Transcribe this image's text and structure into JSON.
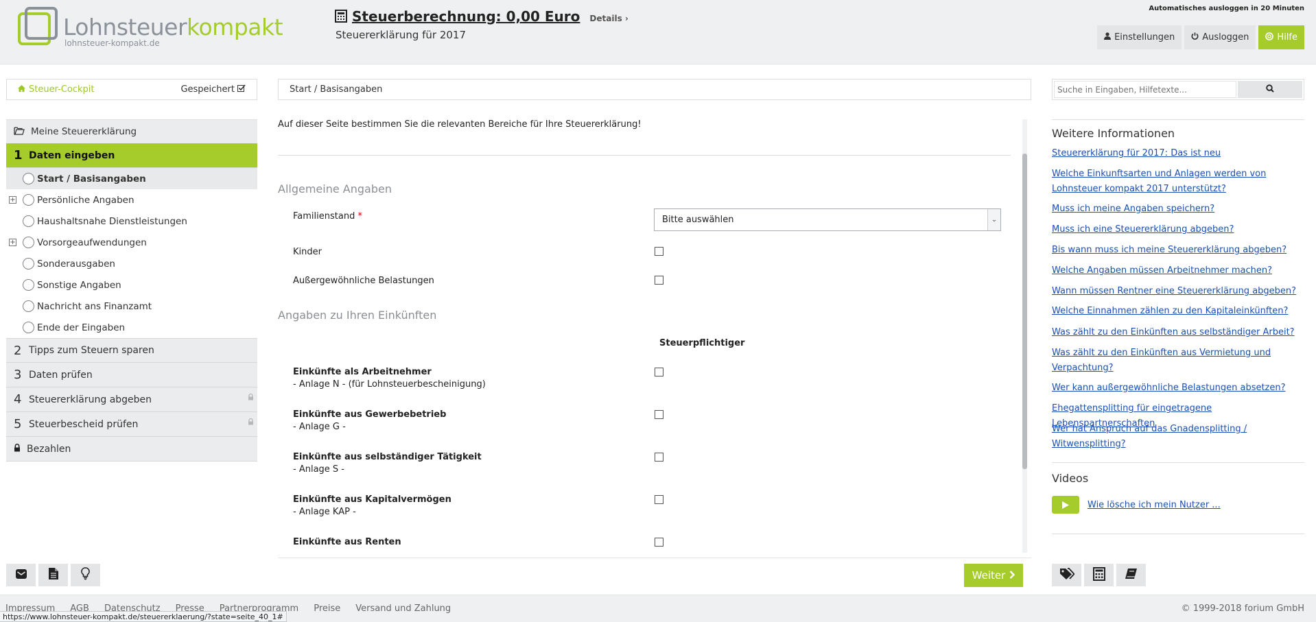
{
  "header": {
    "logo_part1": "Lohnsteuer",
    "logo_part2": "kompakt",
    "logo_sub": "lohnsteuer-kompakt.de",
    "tax_title": "Steuerberechnung: 0,00 Euro",
    "details_label": "Details",
    "tax_year": "Steuererklärung für 2017",
    "auto_logout": "Automatisches ausloggen in 20 Minuten",
    "btn_settings": "Einstellungen",
    "btn_logout": "Ausloggen",
    "btn_help": "Hilfe"
  },
  "sidebar": {
    "cockpit": "Steuer-Cockpit",
    "saved": "Gespeichert",
    "my_return": "Meine Steuererklärung",
    "step1": {
      "num": "1",
      "label": "Daten eingeben"
    },
    "subitems": [
      "Start / Basisangaben",
      "Persönliche Angaben",
      "Haushaltsnahe Dienstleistungen",
      "Vorsorgeaufwendungen",
      "Sonderausgaben",
      "Sonstige Angaben",
      "Nachricht ans Finanzamt",
      "Ende der Eingaben"
    ],
    "steps": [
      {
        "num": "2",
        "label": "Tipps zum Steuern sparen"
      },
      {
        "num": "3",
        "label": "Daten prüfen"
      },
      {
        "num": "4",
        "label": "Steuererklärung abgeben"
      },
      {
        "num": "5",
        "label": "Steuerbescheid prüfen"
      }
    ],
    "pay": "Bezahlen"
  },
  "main": {
    "breadcrumb": "Start / Basisangaben",
    "intro": "Auf dieser Seite bestimmen Sie die relevanten Bereiche für Ihre Steuererklärung!",
    "section1": "Allgemeine Angaben",
    "familienstand_label": "Familienstand",
    "required_mark": "*",
    "familienstand_value": "Bitte auswählen",
    "kinder_label": "Kinder",
    "belastungen_label": "Außergewöhnliche Belastungen",
    "section2": "Angaben zu Ihren Einkünften",
    "column_head": "Steuerpflichtiger",
    "income": [
      {
        "title": "Einkünfte als Arbeitnehmer",
        "sub": "- Anlage N - (für Lohnsteuerbescheinigung)"
      },
      {
        "title": "Einkünfte aus Gewerbebetrieb",
        "sub": "- Anlage G -"
      },
      {
        "title": "Einkünfte aus selbständiger Tätigkeit",
        "sub": "- Anlage S -"
      },
      {
        "title": "Einkünfte aus Kapitalvermögen",
        "sub": "- Anlage KAP -"
      },
      {
        "title": "Einkünfte aus Renten",
        "sub": ""
      }
    ],
    "next_button": "Weiter"
  },
  "right": {
    "search_placeholder": "Suche in Eingaben, Hilfetexte...",
    "more_info_title": "Weitere Informationen",
    "links": [
      "Steuererklärung für 2017: Das ist neu",
      "Welche Einkunftsarten und Anlagen werden von Lohnsteuer kompakt 2017 unterstützt?",
      "Muss ich meine Angaben speichern?",
      "Muss ich eine Steuererklärung abgeben?",
      "Bis wann muss ich meine Steuererklärung abgeben?",
      "Welche Angaben müssen Arbeitnehmer machen?",
      "Wann müssen Rentner eine Steuererklärung abgeben?",
      "Welche Einnahmen zählen zu den Kapitaleinkünften?",
      "Was zählt zu den Einkünften aus selbständiger Arbeit?",
      "Was zählt zu den Einkünften aus Vermietung und Verpachtung?",
      "Wer kann außergewöhnliche Belastungen absetzen?",
      "Ehegattensplitting für eingetragene Lebenspartnerschaften",
      "Wer hat Anspruch auf das Gnadensplitting / Witwensplitting?"
    ],
    "videos_title": "Videos",
    "video_link": "Wie lösche ich mein Nutzer ..."
  },
  "footer": {
    "links": [
      "Impressum",
      "AGB",
      "Datenschutz",
      "Presse",
      "Partnerprogramm",
      "Preise",
      "Versand und Zahlung"
    ],
    "copyright": "© 1999-2018 forium GmbH",
    "status_url": "https://www.lohnsteuer-kompakt.de/steuererklaerung/?state=seite_40_1#"
  },
  "colors": {
    "accent": "#a6cc2b",
    "link": "#1a4fb3"
  }
}
